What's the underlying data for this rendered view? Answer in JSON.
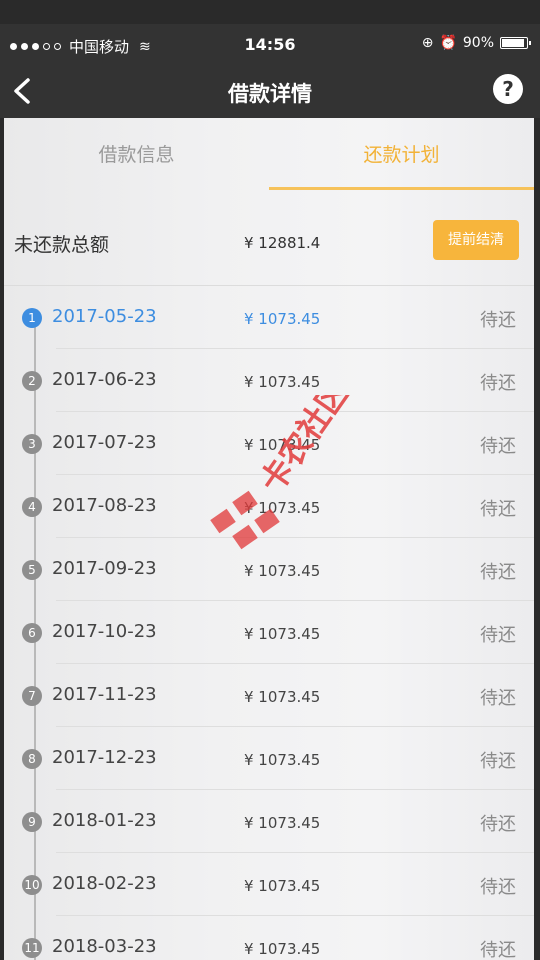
{
  "status_bar": {
    "carrier": "中国移动",
    "time": "14:56",
    "battery": "90%",
    "battery_level": 0.9
  },
  "nav": {
    "title": "借款详情",
    "help": "?"
  },
  "tabs": [
    {
      "label": "借款信息",
      "active": false
    },
    {
      "label": "还款计划",
      "active": true
    }
  ],
  "summary": {
    "label": "未还款总额",
    "amount": "¥ 12881.4",
    "prepay_button": "提前结清"
  },
  "schedule": [
    {
      "index": "1",
      "date": "2017-05-23",
      "amount": "¥ 1073.45",
      "status": "待还",
      "active": true
    },
    {
      "index": "2",
      "date": "2017-06-23",
      "amount": "¥ 1073.45",
      "status": "待还",
      "active": false
    },
    {
      "index": "3",
      "date": "2017-07-23",
      "amount": "¥ 1073.45",
      "status": "待还",
      "active": false
    },
    {
      "index": "4",
      "date": "2017-08-23",
      "amount": "¥ 1073.45",
      "status": "待还",
      "active": false
    },
    {
      "index": "5",
      "date": "2017-09-23",
      "amount": "¥ 1073.45",
      "status": "待还",
      "active": false
    },
    {
      "index": "6",
      "date": "2017-10-23",
      "amount": "¥ 1073.45",
      "status": "待还",
      "active": false
    },
    {
      "index": "7",
      "date": "2017-11-23",
      "amount": "¥ 1073.45",
      "status": "待还",
      "active": false
    },
    {
      "index": "8",
      "date": "2017-12-23",
      "amount": "¥ 1073.45",
      "status": "待还",
      "active": false
    },
    {
      "index": "9",
      "date": "2018-01-23",
      "amount": "¥ 1073.45",
      "status": "待还",
      "active": false
    },
    {
      "index": "10",
      "date": "2018-02-23",
      "amount": "¥ 1073.45",
      "status": "待还",
      "active": false
    },
    {
      "index": "11",
      "date": "2018-03-23",
      "amount": "¥ 1073.45",
      "status": "待还",
      "active": false
    }
  ],
  "watermark": {
    "text": "卡农社区"
  },
  "colors": {
    "accent": "#f7b53c",
    "active_blue": "#3d8de0",
    "header": "#333333"
  }
}
